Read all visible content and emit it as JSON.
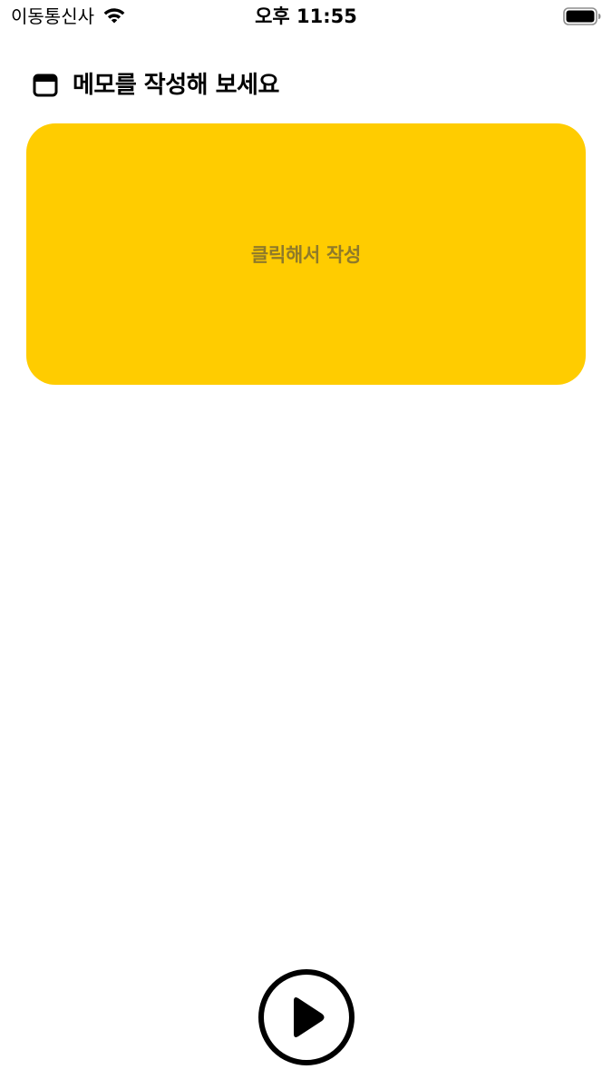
{
  "status_bar": {
    "carrier": "이동통신사",
    "time": "오후 11:55",
    "wifi_icon": "wifi-icon",
    "battery_icon": "battery-icon"
  },
  "header": {
    "icon": "window-icon",
    "title": "메모를 작성해 보세요"
  },
  "memo": {
    "placeholder": "클릭해서 작성",
    "color": "#ffcc00"
  },
  "footer": {
    "play_icon": "play-icon"
  }
}
